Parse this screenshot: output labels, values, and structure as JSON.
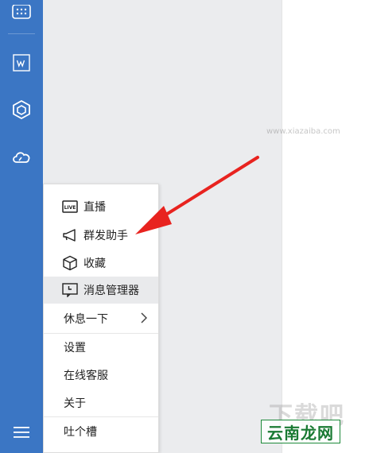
{
  "colors": {
    "sidebar": "#3b76c4",
    "list_pane": "#ebecee",
    "arrow": "#e8231f",
    "watermark_green": "#1a7a33"
  },
  "sidebar": {
    "icons": [
      "grid-apps-icon",
      "w-document-icon",
      "cube-icon",
      "cloud-icon",
      "hamburger-menu-icon"
    ]
  },
  "menu": {
    "items": [
      {
        "label": "直播",
        "icon": "live-icon"
      },
      {
        "label": "群发助手",
        "icon": "megaphone-icon"
      },
      {
        "label": "收藏",
        "icon": "cube-icon"
      },
      {
        "label": "消息管理器",
        "icon": "message-manager-icon",
        "highlighted": true
      },
      {
        "label": "休息一下",
        "icon": "chevron-right-icon",
        "has_submenu": true
      },
      {
        "label": "设置"
      },
      {
        "label": "在线客服"
      },
      {
        "label": "关于"
      },
      {
        "label": "吐个槽"
      }
    ]
  },
  "watermark": {
    "ghost_text": "下载吧",
    "url_text": "www.xiazaiba.com",
    "logo_text": "云南龙网"
  }
}
